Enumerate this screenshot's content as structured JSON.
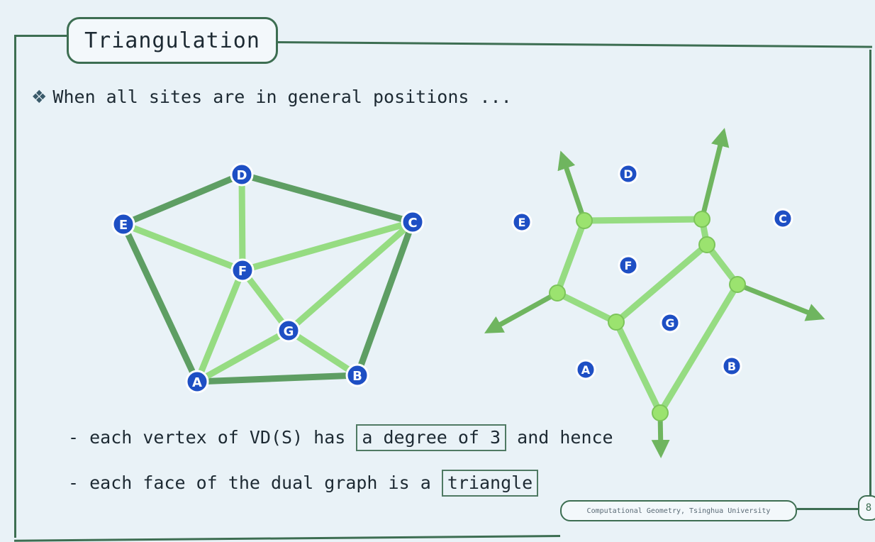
{
  "slide": {
    "title": "Triangulation",
    "bullet_text": "When all sites are in general positions ...",
    "line1_prefix": "- each vertex of VD(S) has",
    "line1_boxed": "a degree of 3",
    "line1_suffix": "and hence",
    "line2_prefix": "- each face of the dual graph is a",
    "line2_boxed": "triangle",
    "footer": "Computational Geometry, Tsinghua University",
    "page_number": "8"
  },
  "colors": {
    "frame": "#3d6e52",
    "edge_dark": "#5e9e63",
    "edge_light": "#96dc82",
    "site_fill": "#1e4fc4",
    "voronoi_vertex": "#9be36f"
  },
  "diagram": {
    "sites": [
      "A",
      "B",
      "C",
      "D",
      "E",
      "F",
      "G"
    ]
  }
}
